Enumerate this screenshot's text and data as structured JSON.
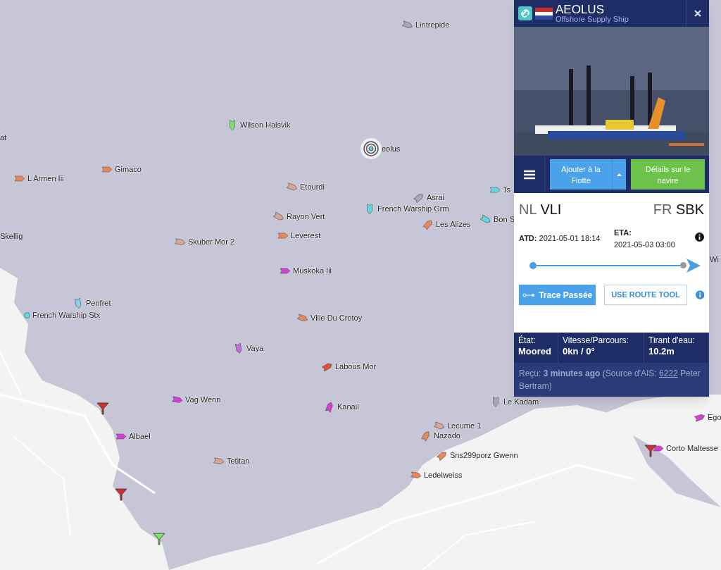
{
  "map": {
    "vessels": [
      {
        "name": "Lintrepide",
        "color": "#a8a8b4"
      },
      {
        "name": "Wilson Halsvik",
        "color": "#7ee06a"
      },
      {
        "name": "Gimaco",
        "color": "#e8875a"
      },
      {
        "name": "L Armen Iii",
        "color": "#e8875a"
      },
      {
        "name": "Etourdi",
        "color": "#d9a595"
      },
      {
        "name": "Asrai",
        "color": "#a8a8b4"
      },
      {
        "name": "French Warship Grm",
        "color": "#5fd8e0"
      },
      {
        "name": "Ts",
        "color": "#5fd8e0"
      },
      {
        "name": "Rayon Vert",
        "color": "#d9a595"
      },
      {
        "name": "Les Alizes",
        "color": "#e8875a"
      },
      {
        "name": "Bon S",
        "color": "#5fd8e0"
      },
      {
        "name": "Leverest",
        "color": "#e8875a"
      },
      {
        "name": "Skuber Mor 2",
        "color": "#d9a595"
      },
      {
        "name": "Muskoka Iii",
        "color": "#d43fd4"
      },
      {
        "name": "Penfret",
        "color": "#8fd0e8"
      },
      {
        "name": "French Warship Stx",
        "color": "#5fd8e0"
      },
      {
        "name": "Ville Du Crotoy",
        "color": "#e8875a"
      },
      {
        "name": "Vaya",
        "color": "#c86ad8"
      },
      {
        "name": "Labous Mor",
        "color": "#e05030"
      },
      {
        "name": "Vag Wenn",
        "color": "#d43fd4"
      },
      {
        "name": "Kanail",
        "color": "#d43fd4"
      },
      {
        "name": "Le Kadam",
        "color": "#a8a8b4"
      },
      {
        "name": "Lecume 1",
        "color": "#d9a595"
      },
      {
        "name": "Nazado",
        "color": "#e8875a"
      },
      {
        "name": "Albael",
        "color": "#d43fd4"
      },
      {
        "name": "Sns299porz Gwenn",
        "color": "#e8875a"
      },
      {
        "name": "Tetitan",
        "color": "#d9a595"
      },
      {
        "name": "Ledelweiss",
        "color": "#e8875a"
      },
      {
        "name": "Corto Maltesse",
        "color": "#d43fd4"
      },
      {
        "name": "Ego",
        "color": "#d43fd4"
      }
    ],
    "cut_labels": [
      "at",
      "Skellig",
      "Wi"
    ],
    "selected_vessel": "eolus"
  },
  "vessel_panel": {
    "title": "AEOLUS",
    "subtitle": "Offshore Supply Ship",
    "buttons": [
      {
        "label": "Ajouter à la Flotte"
      },
      {
        "label": "Détails sur le navire"
      }
    ],
    "origin": {
      "country": "NL",
      "port": "VLI"
    },
    "destination": {
      "country": "FR",
      "port": "SBK"
    },
    "atd": {
      "label": "ATD:",
      "value": "2021-05-01 18:14"
    },
    "eta": {
      "label": "ETA:",
      "value": "2021-05-03 03:00"
    },
    "route": {
      "level": 0.97
    },
    "trace_button": "Trace Passée",
    "route_tool_button": "USE ROUTE TOOL",
    "stats": [
      {
        "label": "État:",
        "value": "Moored"
      },
      {
        "label": "Vitesse/Parcours:",
        "value": "0kn / 0°"
      },
      {
        "label": "Tirant d'eau:",
        "value": "10.2m"
      }
    ],
    "received": {
      "text": "Reçu: **3 minutes ago** (Source d'AIS:",
      "link": "6222",
      "suffix": "Peter Bertram)"
    }
  }
}
